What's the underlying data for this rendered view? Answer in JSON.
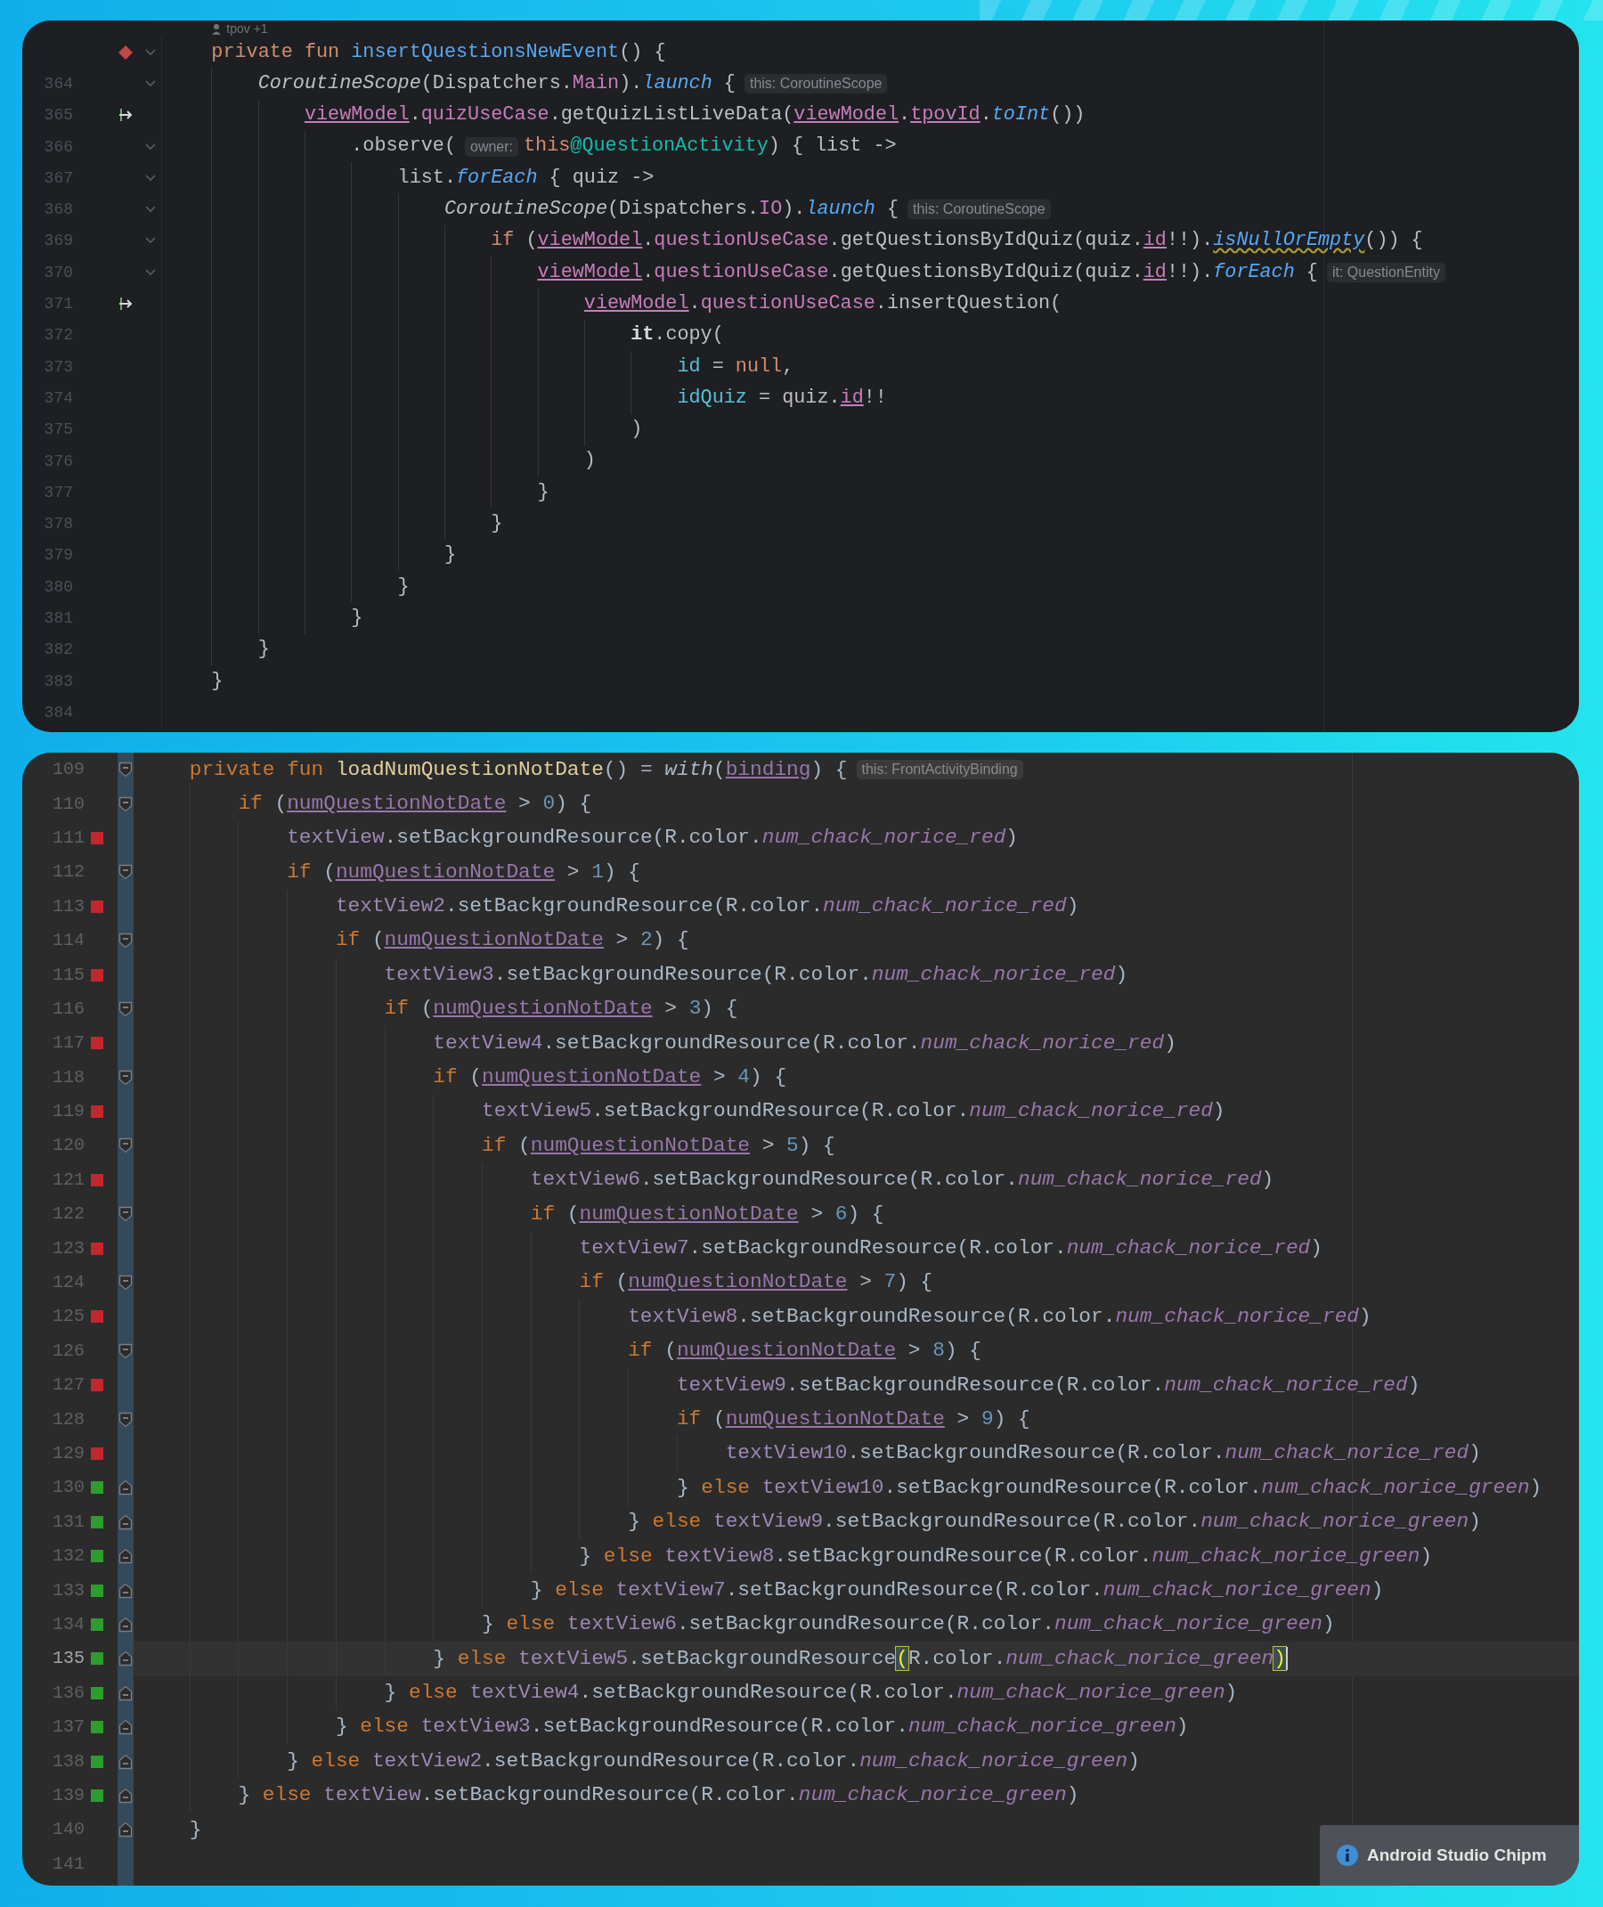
{
  "editors": [
    {
      "code_vision": {
        "text": "tpov +1"
      },
      "lines": [
        {
          "gutter": {
            "kind": "breakpoint"
          },
          "fold": {
            "kind": "open"
          },
          "code": [
            {
              "kind": "kw",
              "text": "    private fun "
            },
            {
              "kind": "decl",
              "text": "insertQuestionsNewEvent"
            },
            {
              "kind": "plain",
              "text": "() {"
            }
          ]
        },
        {
          "number": "364",
          "fold": {
            "kind": "open"
          },
          "code": [
            {
              "kind": "ital",
              "text": "        CoroutineScope"
            },
            {
              "kind": "plain",
              "text": "(Dispatchers."
            },
            {
              "kind": "member",
              "text": "Main"
            },
            {
              "kind": "plain",
              "text": ")."
            },
            {
              "kind": "ext",
              "text": "launch"
            },
            {
              "kind": "plain",
              "text": " {"
            },
            {
              "kind": "hint",
              "text": "this: CoroutineScope"
            }
          ]
        },
        {
          "number": "365",
          "gutter": {
            "kind": "arrow"
          },
          "code": [
            {
              "kind": "prop",
              "text": "            viewModel"
            },
            {
              "kind": "plain",
              "text": "."
            },
            {
              "kind": "member",
              "text": "quizUseCase"
            },
            {
              "kind": "plain",
              "text": ".getQuizListLiveData("
            },
            {
              "kind": "prop",
              "text": "viewModel"
            },
            {
              "kind": "plain",
              "text": "."
            },
            {
              "kind": "prop",
              "text": "tpovId"
            },
            {
              "kind": "plain",
              "text": "."
            },
            {
              "kind": "ext",
              "text": "toInt"
            },
            {
              "kind": "plain",
              "text": "())"
            }
          ]
        },
        {
          "number": "366",
          "fold": {
            "kind": "open"
          },
          "code": [
            {
              "kind": "plain",
              "text": "                .observe("
            },
            {
              "kind": "hint",
              "text": "owner:"
            },
            {
              "kind": "kw",
              "text": "this"
            },
            {
              "kind": "label",
              "text": "@QuestionActivity"
            },
            {
              "kind": "plain",
              "text": ") { list ->"
            }
          ]
        },
        {
          "number": "367",
          "fold": {
            "kind": "open"
          },
          "code": [
            {
              "kind": "plain",
              "text": "                    list."
            },
            {
              "kind": "ext",
              "text": "forEach"
            },
            {
              "kind": "plain",
              "text": " { quiz ->"
            }
          ]
        },
        {
          "number": "368",
          "fold": {
            "kind": "open"
          },
          "code": [
            {
              "kind": "ital",
              "text": "                        CoroutineScope"
            },
            {
              "kind": "plain",
              "text": "(Dispatchers."
            },
            {
              "kind": "member",
              "text": "IO"
            },
            {
              "kind": "plain",
              "text": ")."
            },
            {
              "kind": "ext",
              "text": "launch"
            },
            {
              "kind": "plain",
              "text": " {"
            },
            {
              "kind": "hint",
              "text": "this: CoroutineScope"
            }
          ]
        },
        {
          "number": "369",
          "fold": {
            "kind": "open"
          },
          "code": [
            {
              "kind": "kw",
              "text": "                            if "
            },
            {
              "kind": "plain",
              "text": "("
            },
            {
              "kind": "prop",
              "text": "viewModel"
            },
            {
              "kind": "plain",
              "text": "."
            },
            {
              "kind": "member",
              "text": "questionUseCase"
            },
            {
              "kind": "plain",
              "text": ".getQuestionsByIdQuiz(quiz."
            },
            {
              "kind": "prop",
              "text": "id"
            },
            {
              "kind": "plain",
              "text": "!!)."
            },
            {
              "kind": "warn",
              "text": "isNullOrEmpty"
            },
            {
              "kind": "plain",
              "text": "()) {"
            }
          ]
        },
        {
          "number": "370",
          "fold": {
            "kind": "open"
          },
          "code": [
            {
              "kind": "prop",
              "text": "                                viewModel"
            },
            {
              "kind": "plain",
              "text": "."
            },
            {
              "kind": "member",
              "text": "questionUseCase"
            },
            {
              "kind": "plain",
              "text": ".getQuestionsByIdQuiz(quiz."
            },
            {
              "kind": "prop",
              "text": "id"
            },
            {
              "kind": "plain",
              "text": "!!)."
            },
            {
              "kind": "ext",
              "text": "forEach"
            },
            {
              "kind": "plain",
              "text": " {"
            },
            {
              "kind": "hint",
              "text": "it: QuestionEntity"
            }
          ]
        },
        {
          "number": "371",
          "gutter": {
            "kind": "arrow"
          },
          "code": [
            {
              "kind": "prop",
              "text": "                                    viewModel"
            },
            {
              "kind": "plain",
              "text": "."
            },
            {
              "kind": "member",
              "text": "questionUseCase"
            },
            {
              "kind": "plain",
              "text": ".insertQuestion("
            }
          ]
        },
        {
          "number": "372",
          "code": [
            {
              "kind": "bold",
              "text": "                                        it"
            },
            {
              "kind": "plain",
              "text": ".copy("
            }
          ]
        },
        {
          "number": "373",
          "code": [
            {
              "kind": "named",
              "text": "                                            id"
            },
            {
              "kind": "plain",
              "text": " = "
            },
            {
              "kind": "kw",
              "text": "null"
            },
            {
              "kind": "plain",
              "text": ","
            }
          ]
        },
        {
          "number": "374",
          "code": [
            {
              "kind": "named",
              "text": "                                            idQuiz"
            },
            {
              "kind": "plain",
              "text": " = quiz."
            },
            {
              "kind": "prop",
              "text": "id"
            },
            {
              "kind": "plain",
              "text": "!!"
            }
          ]
        },
        {
          "number": "375",
          "code": [
            {
              "kind": "plain",
              "text": "                                        )"
            }
          ]
        },
        {
          "number": "376",
          "code": [
            {
              "kind": "plain",
              "text": "                                    )"
            }
          ]
        },
        {
          "number": "377",
          "code": [
            {
              "kind": "plain",
              "text": "                                }"
            }
          ]
        },
        {
          "number": "378",
          "code": [
            {
              "kind": "plain",
              "text": "                            }"
            }
          ]
        },
        {
          "number": "379",
          "code": [
            {
              "kind": "plain",
              "text": "                        }"
            }
          ]
        },
        {
          "number": "380",
          "code": [
            {
              "kind": "plain",
              "text": "                    }"
            }
          ]
        },
        {
          "number": "381",
          "code": [
            {
              "kind": "plain",
              "text": "                }"
            }
          ]
        },
        {
          "number": "382",
          "code": [
            {
              "kind": "plain",
              "text": "        }"
            }
          ]
        },
        {
          "number": "383",
          "code": [
            {
              "kind": "plain",
              "text": "    }"
            }
          ]
        },
        {
          "number": "384"
        }
      ]
    },
    {
      "lines": [
        {
          "number": "109",
          "fold": {
            "kind": "start"
          },
          "current": false,
          "code": [
            {
              "kind": "kw",
              "text": "    private fun "
            },
            {
              "kind": "decl",
              "text": "loadNumQuestionNotDate"
            },
            {
              "kind": "plain",
              "text": "() = "
            },
            {
              "kind": "ext",
              "text": "with"
            },
            {
              "kind": "plain",
              "text": "("
            },
            {
              "kind": "prop",
              "text": "binding"
            },
            {
              "kind": "plain",
              "text": ") {"
            },
            {
              "kind": "hint",
              "text": "this: FrontActivityBinding"
            }
          ]
        },
        {
          "number": "110",
          "fold": {
            "kind": "start"
          },
          "current": false,
          "code": [
            {
              "kind": "kw",
              "text": "        if "
            },
            {
              "kind": "plain",
              "text": "("
            },
            {
              "kind": "prop",
              "text": "numQuestionNotDate"
            },
            {
              "kind": "plain",
              "text": " > "
            },
            {
              "kind": "num",
              "text": "0"
            },
            {
              "kind": "plain",
              "text": ") {"
            }
          ]
        },
        {
          "number": "111",
          "color": "#c1272d",
          "current": false,
          "code": [
            {
              "kind": "member",
              "text": "            textView"
            },
            {
              "kind": "plain",
              "text": ".setBackgroundResource(R.color."
            },
            {
              "kind": "res",
              "text": "num_chack_norice_red"
            },
            {
              "kind": "plain",
              "text": ")"
            }
          ]
        },
        {
          "number": "112",
          "fold": {
            "kind": "start"
          },
          "current": false,
          "code": [
            {
              "kind": "kw",
              "text": "            if "
            },
            {
              "kind": "plain",
              "text": "("
            },
            {
              "kind": "prop",
              "text": "numQuestionNotDate"
            },
            {
              "kind": "plain",
              "text": " > "
            },
            {
              "kind": "num",
              "text": "1"
            },
            {
              "kind": "plain",
              "text": ") {"
            }
          ]
        },
        {
          "number": "113",
          "color": "#c1272d",
          "current": false,
          "code": [
            {
              "kind": "member",
              "text": "                textView2"
            },
            {
              "kind": "plain",
              "text": ".setBackgroundResource(R.color."
            },
            {
              "kind": "res",
              "text": "num_chack_norice_red"
            },
            {
              "kind": "plain",
              "text": ")"
            }
          ]
        },
        {
          "number": "114",
          "fold": {
            "kind": "start"
          },
          "current": false,
          "code": [
            {
              "kind": "kw",
              "text": "                if "
            },
            {
              "kind": "plain",
              "text": "("
            },
            {
              "kind": "prop",
              "text": "numQuestionNotDate"
            },
            {
              "kind": "plain",
              "text": " > "
            },
            {
              "kind": "num",
              "text": "2"
            },
            {
              "kind": "plain",
              "text": ") {"
            }
          ]
        },
        {
          "number": "115",
          "color": "#c1272d",
          "current": false,
          "code": [
            {
              "kind": "member",
              "text": "                    textView3"
            },
            {
              "kind": "plain",
              "text": ".setBackgroundResource(R.color."
            },
            {
              "kind": "res",
              "text": "num_chack_norice_red"
            },
            {
              "kind": "plain",
              "text": ")"
            }
          ]
        },
        {
          "number": "116",
          "fold": {
            "kind": "start"
          },
          "current": false,
          "code": [
            {
              "kind": "kw",
              "text": "                    if "
            },
            {
              "kind": "plain",
              "text": "("
            },
            {
              "kind": "prop",
              "text": "numQuestionNotDate"
            },
            {
              "kind": "plain",
              "text": " > "
            },
            {
              "kind": "num",
              "text": "3"
            },
            {
              "kind": "plain",
              "text": ") {"
            }
          ]
        },
        {
          "number": "117",
          "color": "#c1272d",
          "current": false,
          "code": [
            {
              "kind": "member",
              "text": "                        textView4"
            },
            {
              "kind": "plain",
              "text": ".setBackgroundResource(R.color."
            },
            {
              "kind": "res",
              "text": "num_chack_norice_red"
            },
            {
              "kind": "plain",
              "text": ")"
            }
          ]
        },
        {
          "number": "118",
          "fold": {
            "kind": "start"
          },
          "current": false,
          "code": [
            {
              "kind": "kw",
              "text": "                        if "
            },
            {
              "kind": "plain",
              "text": "("
            },
            {
              "kind": "prop",
              "text": "numQuestionNotDate"
            },
            {
              "kind": "plain",
              "text": " > "
            },
            {
              "kind": "num",
              "text": "4"
            },
            {
              "kind": "plain",
              "text": ") {"
            }
          ]
        },
        {
          "number": "119",
          "color": "#c1272d",
          "current": false,
          "code": [
            {
              "kind": "member",
              "text": "                            textView5"
            },
            {
              "kind": "plain",
              "text": ".setBackgroundResource(R.color."
            },
            {
              "kind": "res",
              "text": "num_chack_norice_red"
            },
            {
              "kind": "plain",
              "text": ")"
            }
          ]
        },
        {
          "number": "120",
          "fold": {
            "kind": "start"
          },
          "current": false,
          "code": [
            {
              "kind": "kw",
              "text": "                            if "
            },
            {
              "kind": "plain",
              "text": "("
            },
            {
              "kind": "prop",
              "text": "numQuestionNotDate"
            },
            {
              "kind": "plain",
              "text": " > "
            },
            {
              "kind": "num",
              "text": "5"
            },
            {
              "kind": "plain",
              "text": ") {"
            }
          ]
        },
        {
          "number": "121",
          "color": "#c1272d",
          "current": false,
          "code": [
            {
              "kind": "member",
              "text": "                                textView6"
            },
            {
              "kind": "plain",
              "text": ".setBackgroundResource(R.color."
            },
            {
              "kind": "res",
              "text": "num_chack_norice_red"
            },
            {
              "kind": "plain",
              "text": ")"
            }
          ]
        },
        {
          "number": "122",
          "fold": {
            "kind": "start"
          },
          "current": false,
          "code": [
            {
              "kind": "kw",
              "text": "                                if "
            },
            {
              "kind": "plain",
              "text": "("
            },
            {
              "kind": "prop",
              "text": "numQuestionNotDate"
            },
            {
              "kind": "plain",
              "text": " > "
            },
            {
              "kind": "num",
              "text": "6"
            },
            {
              "kind": "plain",
              "text": ") {"
            }
          ]
        },
        {
          "number": "123",
          "color": "#c1272d",
          "current": false,
          "code": [
            {
              "kind": "member",
              "text": "                                    textView7"
            },
            {
              "kind": "plain",
              "text": ".setBackgroundResource(R.color."
            },
            {
              "kind": "res",
              "text": "num_chack_norice_red"
            },
            {
              "kind": "plain",
              "text": ")"
            }
          ]
        },
        {
          "number": "124",
          "fold": {
            "kind": "start"
          },
          "current": false,
          "code": [
            {
              "kind": "kw",
              "text": "                                    if "
            },
            {
              "kind": "plain",
              "text": "("
            },
            {
              "kind": "prop",
              "text": "numQuestionNotDate"
            },
            {
              "kind": "plain",
              "text": " > "
            },
            {
              "kind": "num",
              "text": "7"
            },
            {
              "kind": "plain",
              "text": ") {"
            }
          ]
        },
        {
          "number": "125",
          "color": "#c1272d",
          "current": false,
          "code": [
            {
              "kind": "member",
              "text": "                                        textView8"
            },
            {
              "kind": "plain",
              "text": ".setBackgroundResource(R.color."
            },
            {
              "kind": "res",
              "text": "num_chack_norice_red"
            },
            {
              "kind": "plain",
              "text": ")"
            }
          ]
        },
        {
          "number": "126",
          "fold": {
            "kind": "start"
          },
          "current": false,
          "code": [
            {
              "kind": "kw",
              "text": "                                        if "
            },
            {
              "kind": "plain",
              "text": "("
            },
            {
              "kind": "prop",
              "text": "numQuestionNotDate"
            },
            {
              "kind": "plain",
              "text": " > "
            },
            {
              "kind": "num",
              "text": "8"
            },
            {
              "kind": "plain",
              "text": ") {"
            }
          ]
        },
        {
          "number": "127",
          "color": "#c1272d",
          "current": false,
          "code": [
            {
              "kind": "member",
              "text": "                                            textView9"
            },
            {
              "kind": "plain",
              "text": ".setBackgroundResource(R.color."
            },
            {
              "kind": "res",
              "text": "num_chack_norice_red"
            },
            {
              "kind": "plain",
              "text": ")"
            }
          ]
        },
        {
          "number": "128",
          "fold": {
            "kind": "start"
          },
          "current": false,
          "code": [
            {
              "kind": "kw",
              "text": "                                            if "
            },
            {
              "kind": "plain",
              "text": "("
            },
            {
              "kind": "prop",
              "text": "numQuestionNotDate"
            },
            {
              "kind": "plain",
              "text": " > "
            },
            {
              "kind": "num",
              "text": "9"
            },
            {
              "kind": "plain",
              "text": ") {"
            }
          ]
        },
        {
          "number": "129",
          "color": "#c1272d",
          "current": false,
          "code": [
            {
              "kind": "member",
              "text": "                                                textView10"
            },
            {
              "kind": "plain",
              "text": ".setBackgroundResource(R.color."
            },
            {
              "kind": "res",
              "text": "num_chack_norice_red"
            },
            {
              "kind": "plain",
              "text": ")"
            }
          ]
        },
        {
          "number": "130",
          "color": "#2e9d2e",
          "fold": {
            "kind": "end"
          },
          "current": false,
          "code": [
            {
              "kind": "plain",
              "text": "                                            } "
            },
            {
              "kind": "kw",
              "text": "else "
            },
            {
              "kind": "member",
              "text": "textView10"
            },
            {
              "kind": "plain",
              "text": ".setBackgroundResource(R.color."
            },
            {
              "kind": "res",
              "text": "num_chack_norice_green"
            },
            {
              "kind": "plain",
              "text": ")"
            }
          ]
        },
        {
          "number": "131",
          "color": "#2e9d2e",
          "fold": {
            "kind": "end"
          },
          "current": false,
          "code": [
            {
              "kind": "plain",
              "text": "                                        } "
            },
            {
              "kind": "kw",
              "text": "else "
            },
            {
              "kind": "member",
              "text": "textView9"
            },
            {
              "kind": "plain",
              "text": ".setBackgroundResource(R.color."
            },
            {
              "kind": "res",
              "text": "num_chack_norice_green"
            },
            {
              "kind": "plain",
              "text": ")"
            }
          ]
        },
        {
          "number": "132",
          "color": "#2e9d2e",
          "fold": {
            "kind": "end"
          },
          "current": false,
          "code": [
            {
              "kind": "plain",
              "text": "                                    } "
            },
            {
              "kind": "kw",
              "text": "else "
            },
            {
              "kind": "member",
              "text": "textView8"
            },
            {
              "kind": "plain",
              "text": ".setBackgroundResource(R.color."
            },
            {
              "kind": "res",
              "text": "num_chack_norice_green"
            },
            {
              "kind": "plain",
              "text": ")"
            }
          ]
        },
        {
          "number": "133",
          "color": "#2e9d2e",
          "fold": {
            "kind": "end"
          },
          "current": false,
          "code": [
            {
              "kind": "plain",
              "text": "                                } "
            },
            {
              "kind": "kw",
              "text": "else "
            },
            {
              "kind": "member",
              "text": "textView7"
            },
            {
              "kind": "plain",
              "text": ".setBackgroundResource(R.color."
            },
            {
              "kind": "res",
              "text": "num_chack_norice_green"
            },
            {
              "kind": "plain",
              "text": ")"
            }
          ]
        },
        {
          "number": "134",
          "color": "#2e9d2e",
          "fold": {
            "kind": "end"
          },
          "current": false,
          "code": [
            {
              "kind": "plain",
              "text": "                            } "
            },
            {
              "kind": "kw",
              "text": "else "
            },
            {
              "kind": "member",
              "text": "textView6"
            },
            {
              "kind": "plain",
              "text": ".setBackgroundResource(R.color."
            },
            {
              "kind": "res",
              "text": "num_chack_norice_green"
            },
            {
              "kind": "plain",
              "text": ")"
            }
          ]
        },
        {
          "number": "135",
          "color": "#2e9d2e",
          "fold": {
            "kind": "end"
          },
          "current": true,
          "code": [
            {
              "kind": "plain",
              "text": "                        } "
            },
            {
              "kind": "kw",
              "text": "else "
            },
            {
              "kind": "member",
              "text": "textView5"
            },
            {
              "kind": "plain",
              "text": ".setBackgroundResource"
            },
            {
              "kind": "match",
              "text": "("
            },
            {
              "kind": "plain",
              "text": "R.color."
            },
            {
              "kind": "res",
              "text": "num_chack_norice_green"
            },
            {
              "kind": "match",
              "text": ")"
            }
          ]
        },
        {
          "number": "136",
          "color": "#2e9d2e",
          "fold": {
            "kind": "end"
          },
          "current": false,
          "code": [
            {
              "kind": "plain",
              "text": "                    } "
            },
            {
              "kind": "kw",
              "text": "else "
            },
            {
              "kind": "member",
              "text": "textView4"
            },
            {
              "kind": "plain",
              "text": ".setBackgroundResource(R.color."
            },
            {
              "kind": "res",
              "text": "num_chack_norice_green"
            },
            {
              "kind": "plain",
              "text": ")"
            }
          ]
        },
        {
          "number": "137",
          "color": "#2e9d2e",
          "fold": {
            "kind": "end"
          },
          "current": false,
          "code": [
            {
              "kind": "plain",
              "text": "                } "
            },
            {
              "kind": "kw",
              "text": "else "
            },
            {
              "kind": "member",
              "text": "textView3"
            },
            {
              "kind": "plain",
              "text": ".setBackgroundResource(R.color."
            },
            {
              "kind": "res",
              "text": "num_chack_norice_green"
            },
            {
              "kind": "plain",
              "text": ")"
            }
          ]
        },
        {
          "number": "138",
          "color": "#2e9d2e",
          "fold": {
            "kind": "end"
          },
          "current": false,
          "code": [
            {
              "kind": "plain",
              "text": "            } "
            },
            {
              "kind": "kw",
              "text": "else "
            },
            {
              "kind": "member",
              "text": "textView2"
            },
            {
              "kind": "plain",
              "text": ".setBackgroundResource(R.color."
            },
            {
              "kind": "res",
              "text": "num_chack_norice_green"
            },
            {
              "kind": "plain",
              "text": ")"
            }
          ]
        },
        {
          "number": "139",
          "color": "#2e9d2e",
          "fold": {
            "kind": "end"
          },
          "current": false,
          "code": [
            {
              "kind": "plain",
              "text": "        } "
            },
            {
              "kind": "kw",
              "text": "else "
            },
            {
              "kind": "member",
              "text": "textView"
            },
            {
              "kind": "plain",
              "text": ".setBackgroundResource(R.color."
            },
            {
              "kind": "res",
              "text": "num_chack_norice_green"
            },
            {
              "kind": "plain",
              "text": ")"
            }
          ]
        },
        {
          "number": "140",
          "fold": {
            "kind": "end"
          },
          "current": false,
          "code": [
            {
              "kind": "plain",
              "text": "    }"
            }
          ]
        },
        {
          "number": "141",
          "current": false
        }
      ]
    }
  ],
  "notification": {
    "title": "Android Studio Chipm"
  }
}
